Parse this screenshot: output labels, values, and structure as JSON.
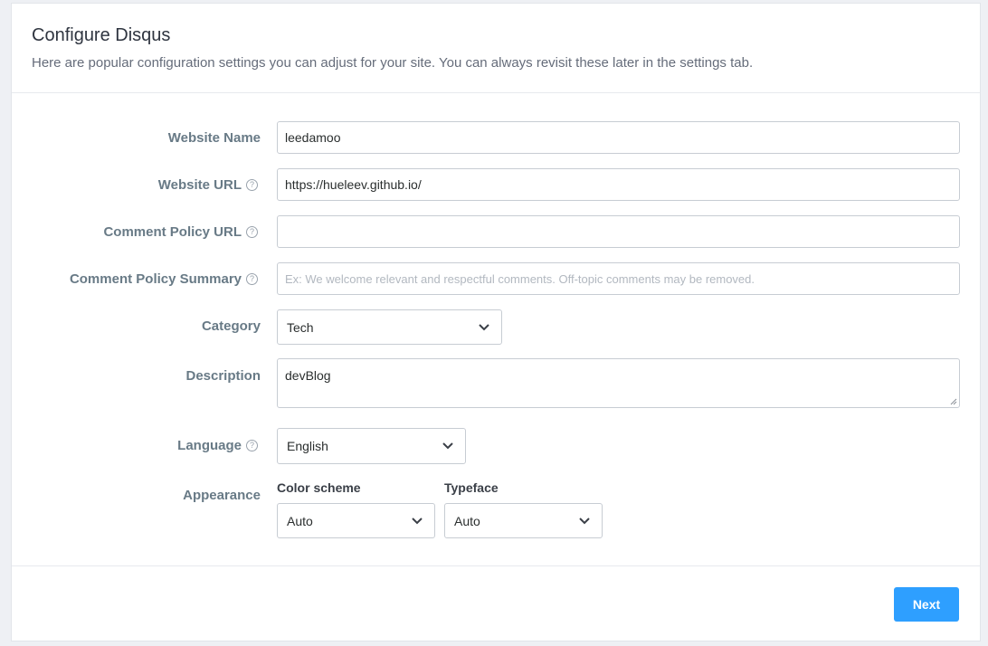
{
  "header": {
    "title": "Configure Disqus",
    "subtitle": "Here are popular configuration settings you can adjust for your site. You can always revisit these later in the settings tab."
  },
  "form": {
    "website_name": {
      "label": "Website Name",
      "value": "leedamoo"
    },
    "website_url": {
      "label": "Website URL",
      "value": "https://hueleev.github.io/"
    },
    "comment_policy_url": {
      "label": "Comment Policy URL",
      "value": ""
    },
    "comment_policy_summary": {
      "label": "Comment Policy Summary",
      "value": "",
      "placeholder": "Ex: We welcome relevant and respectful comments. Off-topic comments may be removed."
    },
    "category": {
      "label": "Category",
      "value": "Tech"
    },
    "description": {
      "label": "Description",
      "value": "devBlog"
    },
    "language": {
      "label": "Language",
      "value": "English"
    },
    "appearance": {
      "label": "Appearance",
      "color_scheme": {
        "label": "Color scheme",
        "value": "Auto"
      },
      "typeface": {
        "label": "Typeface",
        "value": "Auto"
      }
    }
  },
  "footer": {
    "next_label": "Next"
  },
  "colors": {
    "primary": "#2e9fff",
    "label": "#687a86",
    "border": "#c7ccd3"
  },
  "icons": {
    "help": "question-circle-icon",
    "select": "chevron-down-icon"
  }
}
